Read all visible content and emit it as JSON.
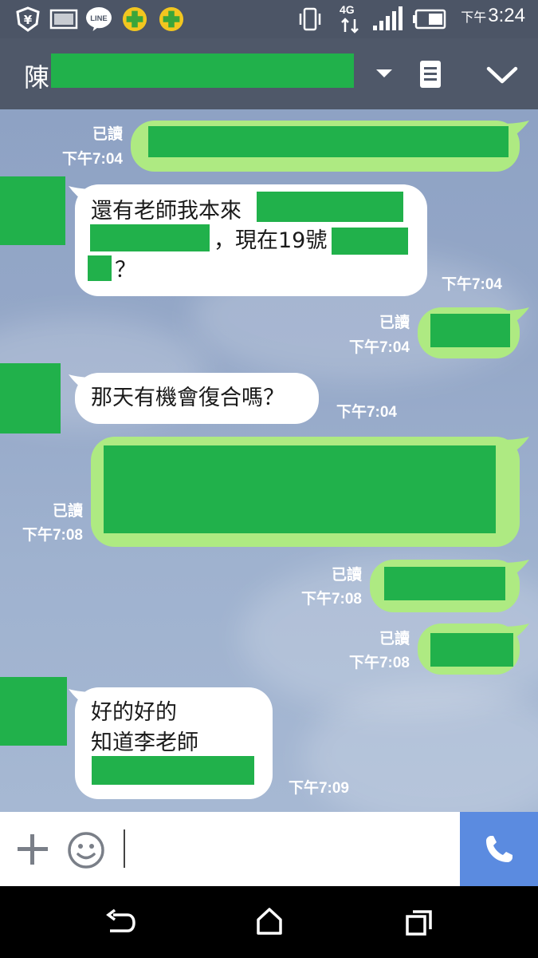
{
  "status_bar": {
    "time_prefix": "下午",
    "time": "3:24",
    "network": "4G",
    "app_icons": [
      "vpn-icon",
      "gallery-icon",
      "line-icon",
      "plus-app-icon",
      "plus-app-icon"
    ]
  },
  "header": {
    "title_initial": "陳"
  },
  "messages": {
    "m1": {
      "read": "已讀",
      "time": "下午7:04"
    },
    "m2": {
      "line1": "還有老師我本來",
      "line2": "，現在19號",
      "line3": "？",
      "time": "下午7:04"
    },
    "m3": {
      "read": "已讀",
      "time": "下午7:04"
    },
    "m4": {
      "text": "那天有機會復合嗎？",
      "time": "下午7:04"
    },
    "m5": {
      "read": "已讀",
      "time": "下午7:08"
    },
    "m6": {
      "read": "已讀",
      "time": "下午7:08"
    },
    "m7": {
      "read": "已讀",
      "time": "下午7:08"
    },
    "m8": {
      "line1": "好的好的",
      "line2": "知道李老師",
      "time": "下午7:09"
    }
  },
  "colors": {
    "outgoing_bubble": "#aeea82",
    "incoming_bubble": "#ffffff",
    "header": "#4f5869",
    "call_button": "#5b8be0",
    "redaction": "#21b14b"
  }
}
